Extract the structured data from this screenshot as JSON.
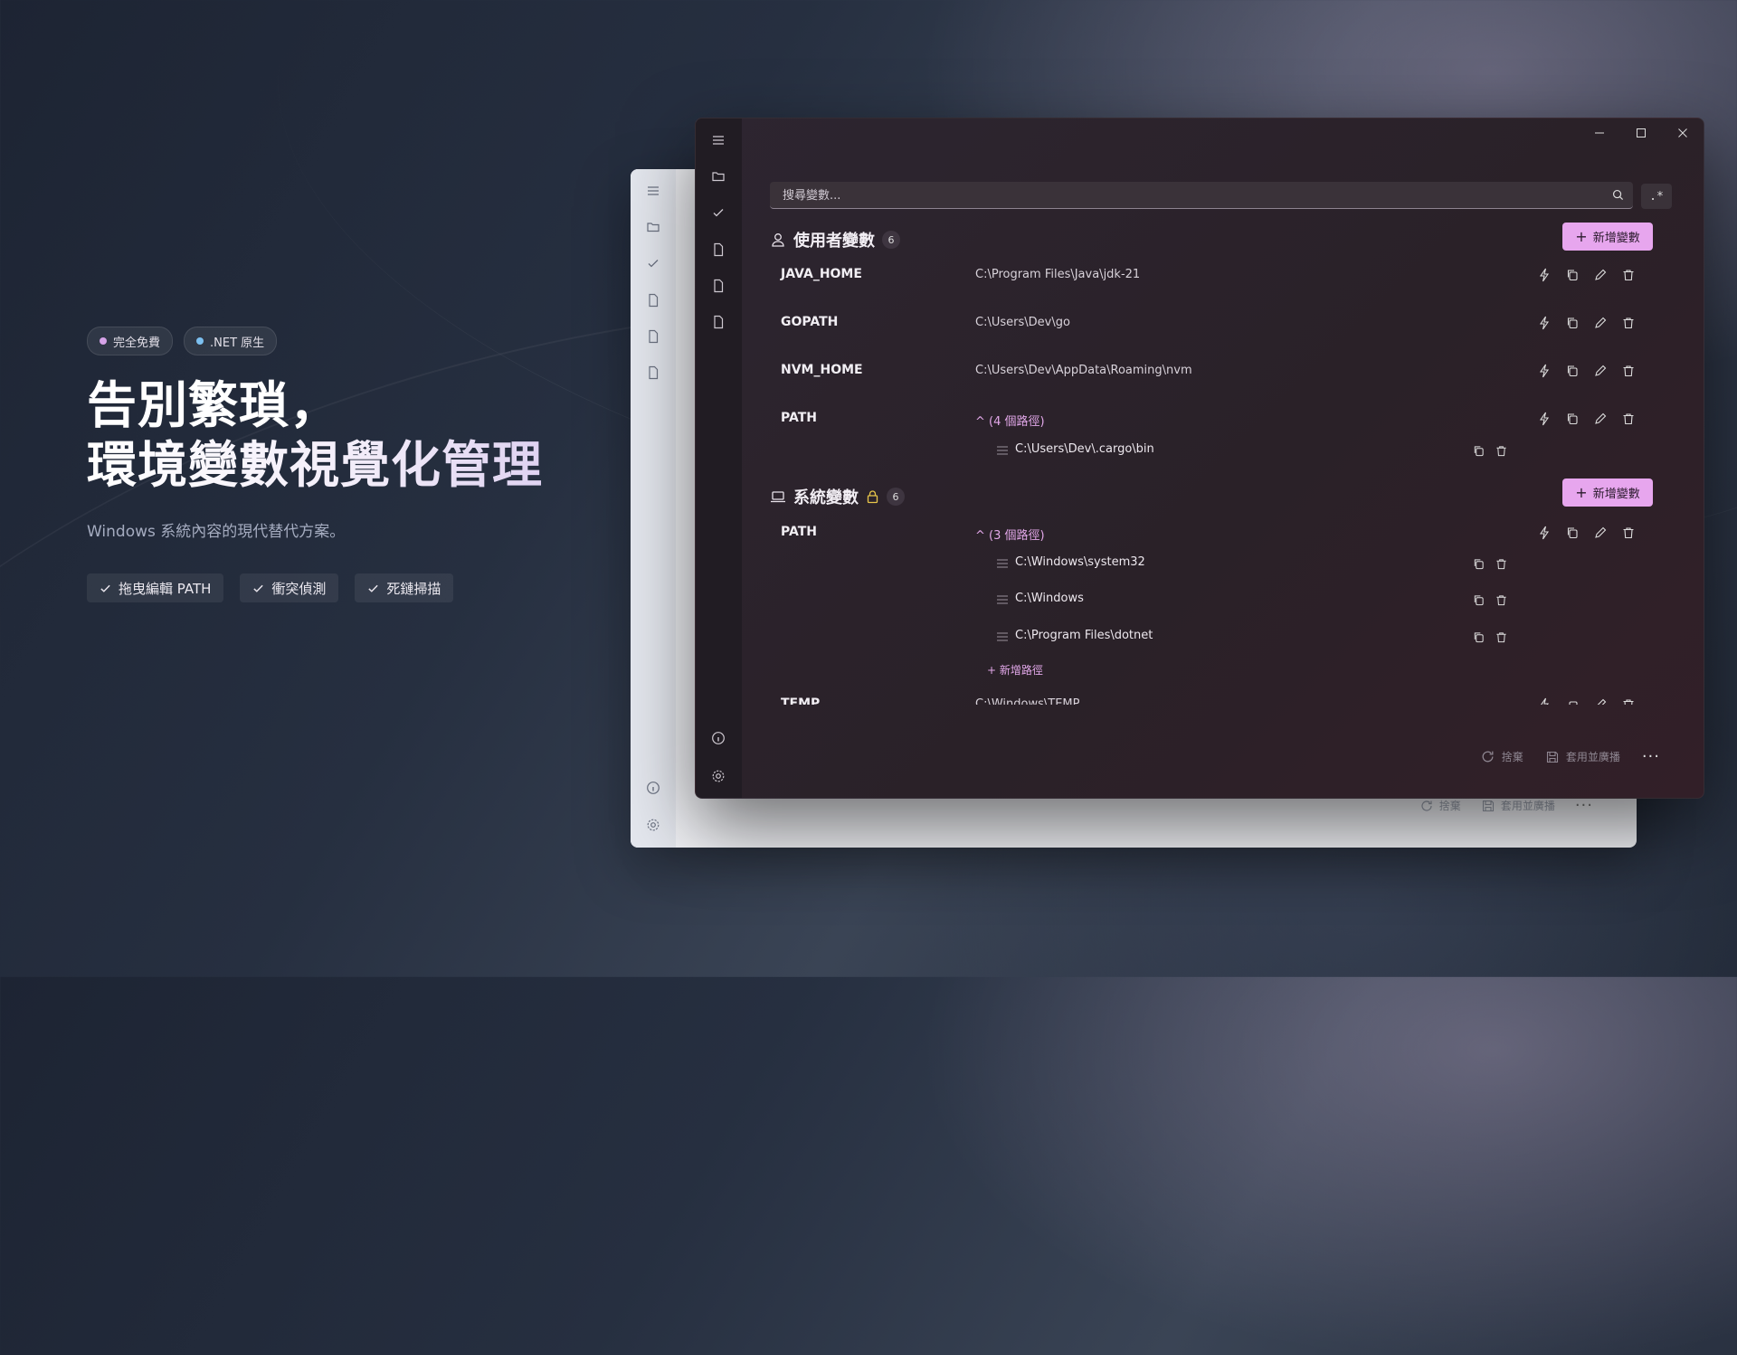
{
  "hero": {
    "badges": [
      {
        "label": "完全免費",
        "color": "#d6a3e8"
      },
      {
        "label": ".NET 原生",
        "color": "#7cc0f0"
      }
    ],
    "headline_line1": "告別繁瑣，",
    "headline_line2": "環境變數視覺化管理",
    "subtitle": "Windows 系統內容的現代替代方案。",
    "features": [
      "拖曳編輯 PATH",
      "衝突偵測",
      "死鏈掃描"
    ]
  },
  "app": {
    "search_placeholder": "搜尋變數...",
    "regex_label": ".*",
    "user_section": {
      "title": "使用者變數",
      "count": "6",
      "add_label": "新增變數",
      "vars": [
        {
          "name": "JAVA_HOME",
          "value": "C:\\Program Files\\Java\\jdk-21"
        },
        {
          "name": "GOPATH",
          "value": "C:\\Users\\Dev\\go"
        },
        {
          "name": "NVM_HOME",
          "value": "C:\\Users\\Dev\\AppData\\Roaming\\nvm"
        },
        {
          "name": "PATH",
          "value": "^ (4 個路徑)",
          "paths": [
            "C:\\Users\\Dev\\.cargo\\bin"
          ]
        }
      ]
    },
    "system_section": {
      "title": "系統變數",
      "count": "6",
      "add_label": "新增變數",
      "vars": [
        {
          "name": "PATH",
          "value": "^ (3 個路徑)",
          "paths": [
            "C:\\Windows\\system32",
            "C:\\Windows",
            "C:\\Program Files\\dotnet"
          ]
        },
        {
          "name": "TEMP",
          "value": "C:\\Windows\\TEMP"
        }
      ],
      "add_path_label": "+ 新增路徑"
    },
    "footer": {
      "revert_label": "捨棄",
      "apply_label": "套用並廣播",
      "more_label": "···"
    }
  },
  "colors": {
    "accent": "#e7a6ee",
    "lock": "#e8c64a"
  }
}
